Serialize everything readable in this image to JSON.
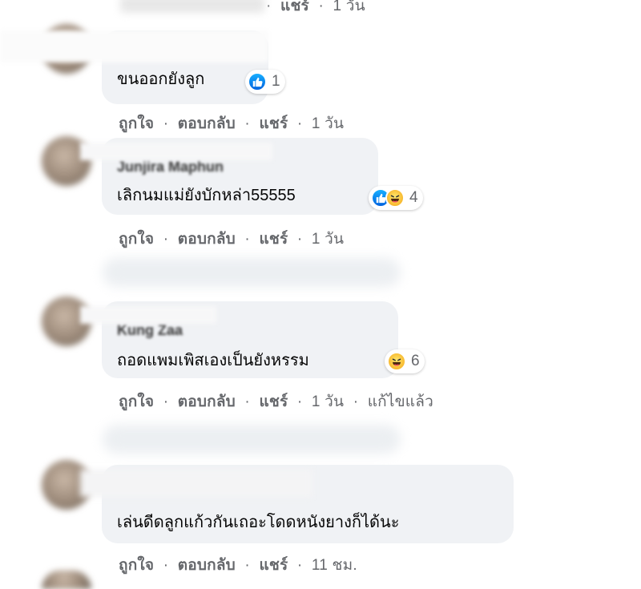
{
  "comments": [
    {
      "text": "ขนออกยังลูก",
      "reaction_count": "1",
      "actions": {
        "like": "ถูกใจ",
        "reply": "ตอบกลับ",
        "share": "แชร์",
        "time": "1 วัน"
      }
    },
    {
      "author": "Junjira Maphun",
      "text": "เลิกนมแม่ยังบักหล่า55555",
      "reaction_count": "4",
      "actions": {
        "like": "ถูกใจ",
        "reply": "ตอบกลับ",
        "share": "แชร์",
        "time": "1 วัน"
      }
    },
    {
      "author": "Kung Zaa",
      "text": "ถอดแพมเพิสเองเป็นยังหรรม",
      "reaction_count": "6",
      "actions": {
        "like": "ถูกใจ",
        "reply": "ตอบกลับ",
        "share": "แชร์",
        "time": "1 วัน",
        "edited": "แก้ไขแล้ว"
      }
    },
    {
      "text": "เล่นดีดลูกแก้วกันเถอะโดดหนังยางก็ได้นะ",
      "actions": {
        "like": "ถูกใจ",
        "reply": "ตอบกลับ",
        "share": "แชร์",
        "time": "11 ชม."
      }
    }
  ],
  "top_partial_meta": {
    "separator": "·",
    "share": "แชร์",
    "time": "1 วัน"
  },
  "separator": "·",
  "colors": {
    "bubble": "#f0f2f5",
    "meta": "#65676b",
    "text": "#050505",
    "like_blue": "#1877f2",
    "haha_yellow": "#f7b125"
  }
}
